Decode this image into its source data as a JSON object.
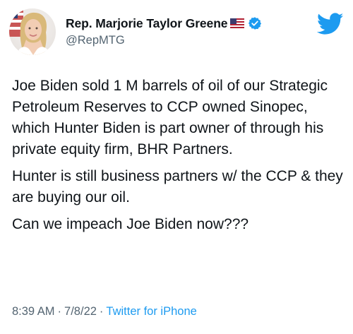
{
  "header": {
    "display_name": "Rep. Marjorie Taylor Greene",
    "handle": "@RepMTG",
    "avatar_icon": "profile-photo",
    "flag_icon": "us-flag-icon",
    "verified_icon": "verified-badge-icon",
    "brand_icon": "twitter-bird-icon"
  },
  "tweet": {
    "paragraphs": [
      "Joe Biden sold 1 M barrels of oil of our Strategic Petroleum Reserves to CCP owned Sinopec, which Hunter Biden is part owner of through his private equity firm, BHR Partners.",
      "Hunter is still business partners w/ the CCP & they are buying our oil.",
      "Can we impeach Joe Biden now???"
    ]
  },
  "meta": {
    "time": "8:39 AM",
    "separator": "·",
    "date": "7/8/22",
    "source": "Twitter for iPhone"
  },
  "colors": {
    "twitter_blue": "#1d9bf0",
    "text_primary": "#0f1419",
    "text_secondary": "#536471"
  }
}
